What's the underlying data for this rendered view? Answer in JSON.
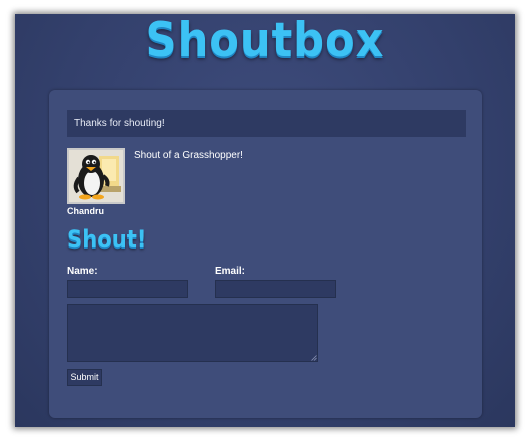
{
  "app": {
    "title": "Shoutbox"
  },
  "flash": {
    "message": "Thanks for shouting!"
  },
  "shouts": [
    {
      "author": "Chandru",
      "message": "Shout of a Grasshopper!",
      "avatar_icon": "penguin-avatar-icon"
    }
  ],
  "form": {
    "heading": "Shout!",
    "name_label": "Name:",
    "name_value": "",
    "email_label": "Email:",
    "email_value": "",
    "message_value": "",
    "submit_label": "Submit"
  },
  "colors": {
    "background": "#33406c",
    "panel": "#3f4d7a",
    "input": "#2e3a62",
    "accent": "#3cc2f4"
  }
}
